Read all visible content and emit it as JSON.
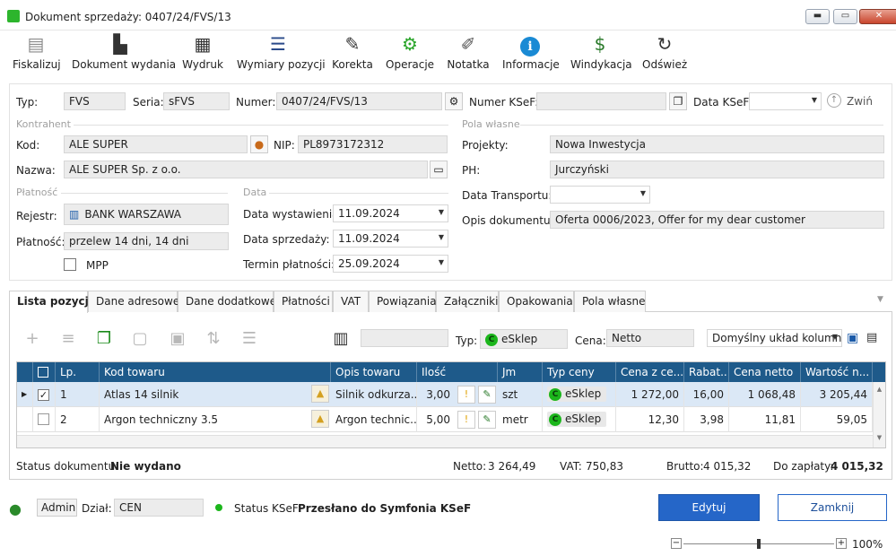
{
  "window": {
    "title": "Dokument sprzedaży: 0407/24/FVS/13",
    "minimize": "▬",
    "maximize": "▭",
    "close": "✕"
  },
  "toolbar": {
    "items": [
      {
        "label": "Fiskalizuj",
        "icon": "fiscal-printer-icon"
      },
      {
        "label": "Dokument wydania",
        "icon": "document-export-icon"
      },
      {
        "label": "Wydruk",
        "icon": "printer-icon"
      },
      {
        "label": "Wymiary pozycji",
        "icon": "list-icon"
      },
      {
        "label": "Korekta",
        "icon": "pencil-icon"
      },
      {
        "label": "Operacje",
        "icon": "gears-icon"
      },
      {
        "label": "Notatka",
        "icon": "note-icon"
      },
      {
        "label": "Informacje",
        "icon": "info-icon"
      },
      {
        "label": "Windykacja",
        "icon": "money-hand-icon"
      },
      {
        "label": "Odśwież",
        "icon": "refresh-icon"
      }
    ]
  },
  "header": {
    "typ_label": "Typ:",
    "typ": "FVS",
    "seria_label": "Seria:",
    "seria": "sFVS",
    "numer_label": "Numer:",
    "numer": "0407/24/FVS/13",
    "numer_ksef_label": "Numer KSeF:",
    "numer_ksef": "",
    "data_ksef_label": "Data KSeF:",
    "data_ksef": "",
    "zwin": "Zwiń"
  },
  "kontrahent": {
    "group": "Kontrahent",
    "kod_label": "Kod:",
    "kod": "ALE SUPER",
    "nip_label": "NIP:",
    "nip": "PL8973172312",
    "nazwa_label": "Nazwa:",
    "nazwa": "ALE SUPER Sp. z o.o."
  },
  "pola_wlasne": {
    "group": "Pola własne",
    "projekty_label": "Projekty:",
    "projekty": "Nowa Inwestycja",
    "ph_label": "PH:",
    "ph": "Jurczyński",
    "transport_label": "Data Transportu:",
    "transport": "",
    "opis_label": "Opis dokumentu:",
    "opis": "Oferta 0006/2023, Offer for my dear customer"
  },
  "platnosc": {
    "group": "Płatność",
    "rejestr_label": "Rejestr:",
    "rejestr": "BANK WARSZAWA",
    "platnosc_label": "Płatność:",
    "platnosc": "przelew 14 dni, 14 dni",
    "mpp": "MPP"
  },
  "data": {
    "group": "Data",
    "wystawienia_label": "Data wystawienia:",
    "wystawienia": "11.09.2024",
    "sprzedazy_label": "Data sprzedaży:",
    "sprzedazy": "11.09.2024",
    "termin_label": "Termin płatności:",
    "termin": "25.09.2024"
  },
  "tabs": [
    "Lista pozycji",
    "Dane adresowe",
    "Dane dodatkowe",
    "Płatności",
    "VAT",
    "Powiązania",
    "Załączniki",
    "Opakowania",
    "Pola własne"
  ],
  "filter": {
    "typ_label": "Typ:",
    "typ": "eSklep",
    "cena_label": "Cena:",
    "cena": "Netto",
    "layout": "Domyślny układ kolumn"
  },
  "grid": {
    "columns": [
      "Lp.",
      "Kod towaru",
      "Opis towaru",
      "Ilość",
      "Jm",
      "Typ ceny",
      "Cena z ce...",
      "Rabat...",
      "Cena netto",
      "Wartość n..."
    ],
    "rows": [
      {
        "lp": "1",
        "kod": "Atlas 14 silnik",
        "opis": "Silnik odkurza...",
        "ilosc": "3,00",
        "jm": "szt",
        "typ": "eSklep",
        "cena_z": "1 272,00",
        "rabat": "16,00",
        "netto": "1 068,48",
        "wartosc": "3 205,44",
        "checked": true
      },
      {
        "lp": "2",
        "kod": "Argon techniczny 3.5",
        "opis": "Argon technic...",
        "ilosc": "5,00",
        "jm": "metr",
        "typ": "eSklep",
        "cena_z": "12,30",
        "rabat": "3,98",
        "netto": "11,81",
        "wartosc": "59,05",
        "checked": false
      }
    ]
  },
  "summary": {
    "status_label": "Status dokumentu:",
    "status": "Nie wydano",
    "netto_label": "Netto:",
    "netto": "3 264,49",
    "vat_label": "VAT:",
    "vat": "750,83",
    "brutto_label": "Brutto:",
    "brutto": "4 015,32",
    "do_zaplaty_label": "Do zapłaty:",
    "do_zaplaty": "4 015,32"
  },
  "footer": {
    "user": "Admin",
    "dzial_label": "Dział:",
    "dzial": "CEN",
    "ksef_label": "Status KSeF:",
    "ksef": "Przesłano do Symfonia KSeF",
    "edit": "Edytuj",
    "close": "Zamknij",
    "zoom": "100%",
    "zoom_minus": "−",
    "zoom_plus": "+"
  },
  "colors": {
    "accent": "#2566c8",
    "grid_header": "#1e5a8a",
    "status_green": "#1cb61c"
  }
}
